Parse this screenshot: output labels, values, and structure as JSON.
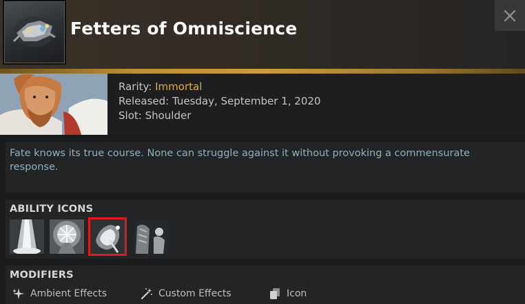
{
  "header": {
    "title": "Fetters of Omniscience",
    "close_glyph": "✕"
  },
  "hero": {
    "rarity_label": "Rarity:",
    "rarity_value": "Immortal",
    "rarity_color": "#e4ae39",
    "released": "Released: Tuesday, September 1, 2020",
    "slot": "Slot: Shoulder"
  },
  "description": "Fate knows its true course. None can struggle against it without provoking a commensurate response.",
  "ability_icons": {
    "label": "ABILITY ICONS",
    "icons": [
      {
        "name": "ability-icon-beam"
      },
      {
        "name": "ability-icon-shield-rays"
      },
      {
        "name": "ability-icon-glowing-hand",
        "selected": true
      },
      {
        "name": "ability-icon-figure"
      }
    ]
  },
  "modifiers": {
    "label": "MODIFIERS",
    "items": [
      {
        "label": "Ambient Effects",
        "icon": "sparkle-icon"
      },
      {
        "label": "Custom Effects",
        "icon": "magic-wand-icon"
      },
      {
        "label": "Icon",
        "icon": "stacked-cards-icon"
      }
    ]
  },
  "colors": {
    "accent_gold": "#c99d3c",
    "description_text": "#8fb1bf",
    "selected_outline": "#e01a1a"
  }
}
